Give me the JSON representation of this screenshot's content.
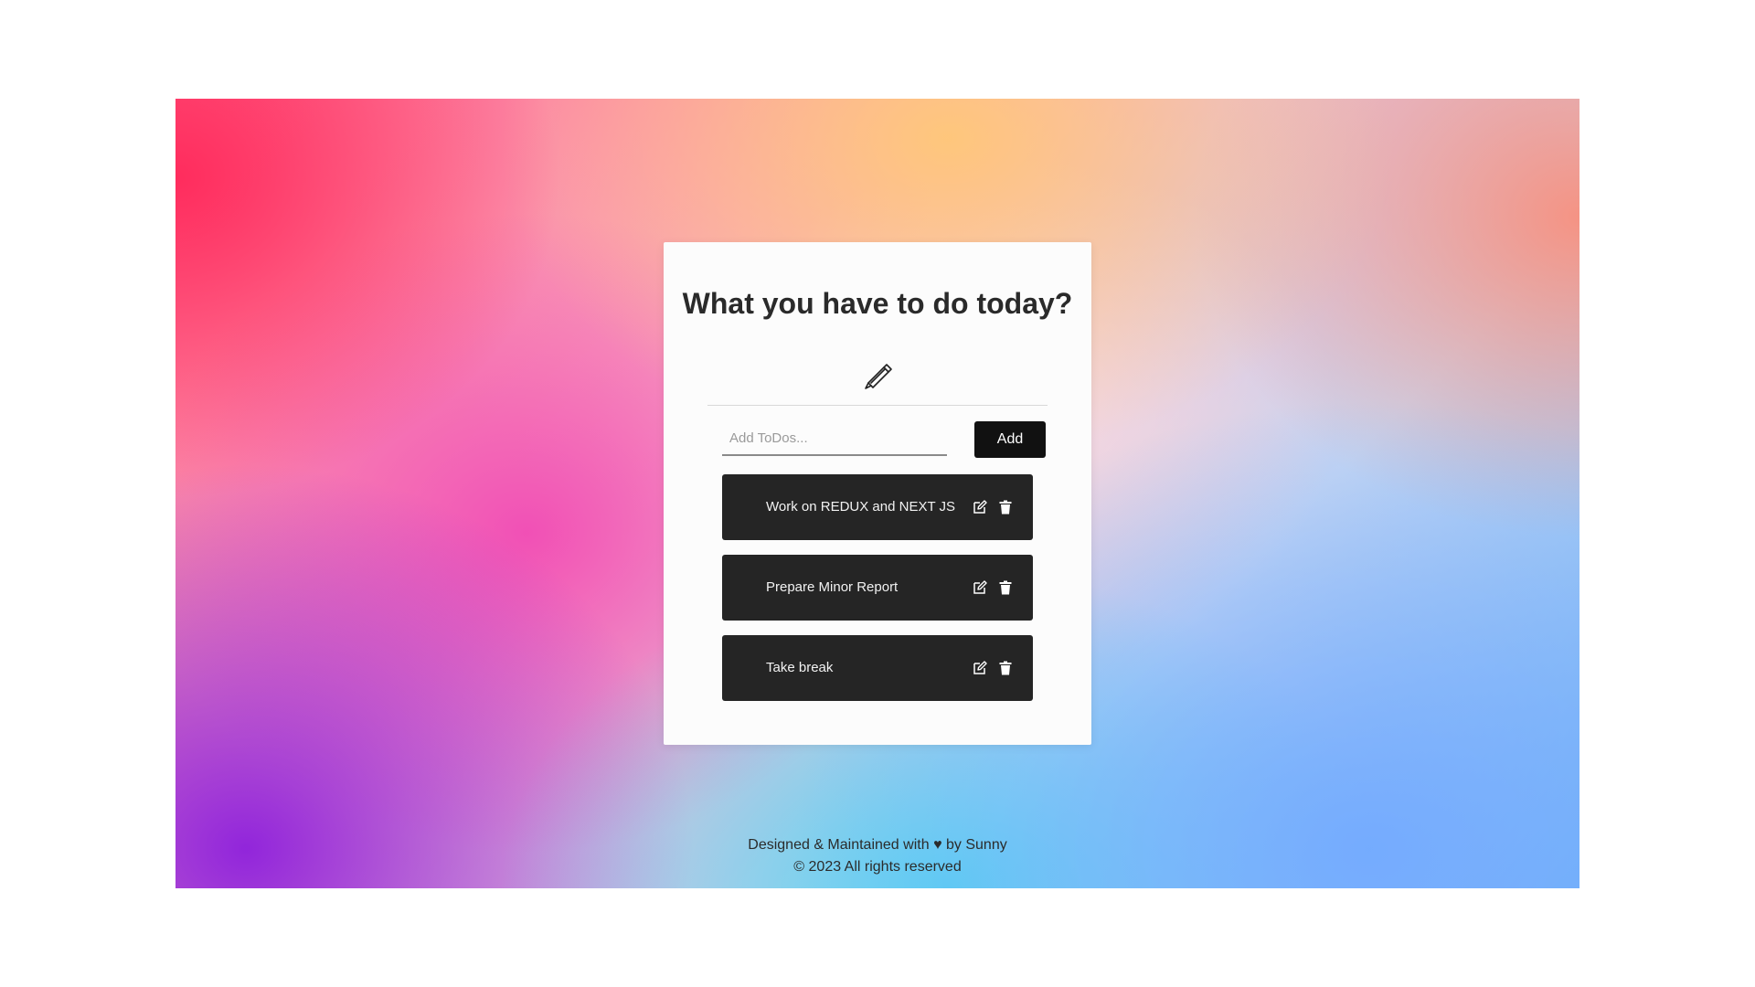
{
  "card": {
    "title": "What you have to do today?",
    "pen_icon": "pen-icon"
  },
  "input": {
    "value": "",
    "placeholder": "Add ToDos..."
  },
  "add_button": {
    "label": "Add"
  },
  "todos": [
    {
      "text": "Work on REDUX and NEXT JS",
      "edit_icon": "edit-icon",
      "delete_icon": "trash-icon"
    },
    {
      "text": "Prepare Minor Report",
      "edit_icon": "edit-icon",
      "delete_icon": "trash-icon"
    },
    {
      "text": "Take break",
      "edit_icon": "edit-icon",
      "delete_icon": "trash-icon"
    }
  ],
  "footer": {
    "line1_before": "Designed & Maintained with",
    "heart": "♥",
    "line1_after": "by Sunny",
    "line2": "© 2023 All rights reserved"
  },
  "colors": {
    "todo_bg": "#252525",
    "button_bg": "#111111",
    "card_bg": "#fcfcfc"
  }
}
